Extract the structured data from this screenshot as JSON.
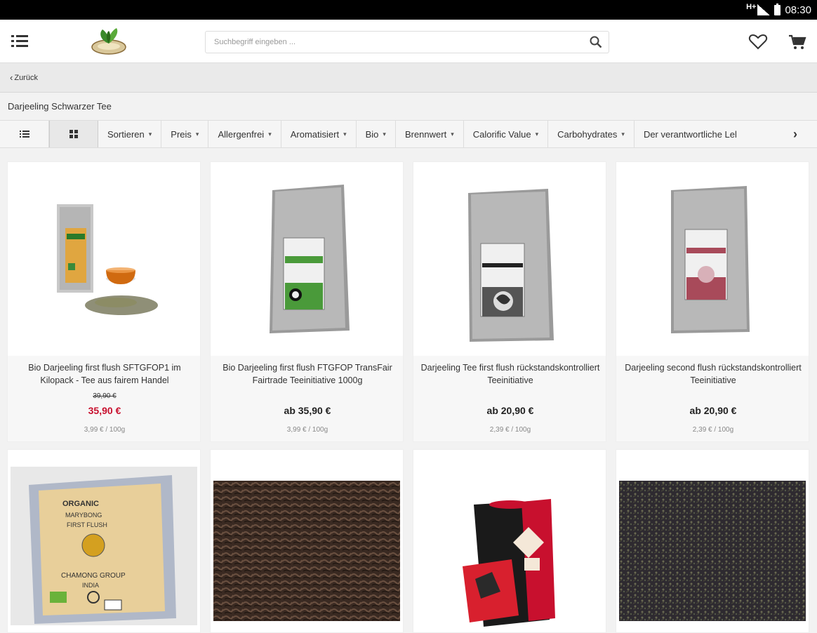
{
  "status_bar": {
    "network": "H+",
    "time": "08:30"
  },
  "header": {
    "search_placeholder": "Suchbegriff eingeben ...",
    "icons": [
      "menu-icon",
      "logo",
      "search-icon",
      "heart-icon",
      "cart-icon"
    ]
  },
  "back": {
    "label": "Zurück"
  },
  "category": {
    "title": "Darjeeling Schwarzer Tee"
  },
  "filters": [
    {
      "label": "Sortieren"
    },
    {
      "label": "Preis"
    },
    {
      "label": "Allergenfrei"
    },
    {
      "label": "Aromatisiert"
    },
    {
      "label": "Bio"
    },
    {
      "label": "Brennwert"
    },
    {
      "label": "Calorific Value"
    },
    {
      "label": "Carbohydrates"
    },
    {
      "label": "Der verantwortliche Lel"
    }
  ],
  "products": [
    {
      "name": "Bio Darjeeling first flush SFTGFOP1 im Kilopack - Tee aus fairem Handel",
      "old_price": "39,90 €",
      "price": "35,90 €",
      "unit_price": "3,99 € / 100g"
    },
    {
      "name": "Bio Darjeeling first flush FTGFOP TransFair Fairtrade Teeinitiative 1000g",
      "old_price": "",
      "price": "ab 35,90 €",
      "unit_price": "3,99 € / 100g"
    },
    {
      "name": "Darjeeling Tee first flush rückstandskontrolliert Teeinitiative",
      "old_price": "",
      "price": "ab 20,90 €",
      "unit_price": "2,39 € / 100g"
    },
    {
      "name": "Darjeeling second flush rückstandskontrolliert Teeinitiative",
      "old_price": "",
      "price": "ab 20,90 €",
      "unit_price": "2,39 € / 100g"
    }
  ],
  "second_row_images": {
    "box_label_lines": [
      "ORGANIC",
      "MARYBONG",
      "FIRST FLUSH",
      "CHAMONG GROUP",
      "INDIA"
    ]
  },
  "colors": {
    "sale": "#c8102e",
    "fairtrade_green": "#4a9a3a",
    "red_box": "#c8102e"
  }
}
